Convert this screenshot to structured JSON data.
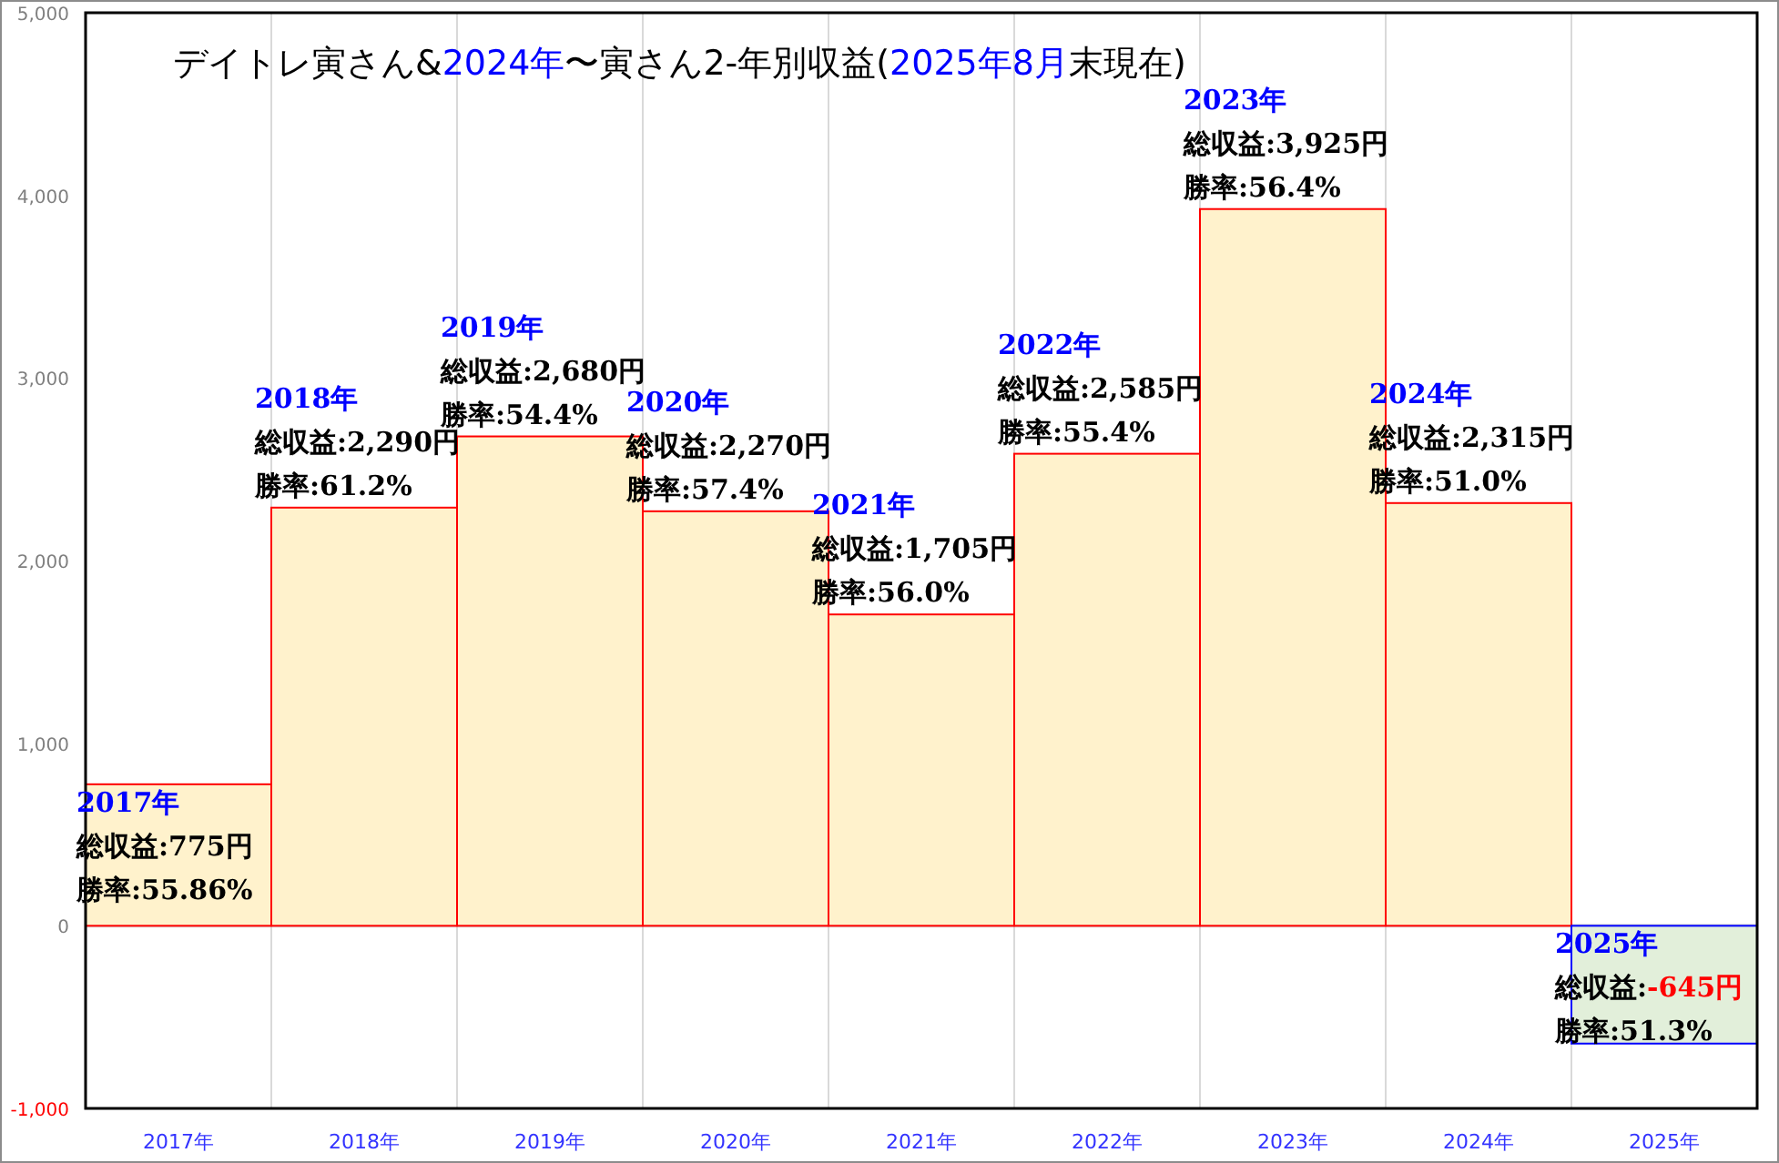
{
  "chart": {
    "title": [
      {
        "text": "デイトレ寅さん&",
        "color": "#000000"
      },
      {
        "text": "2024年",
        "color": "#0000ff"
      },
      {
        "text": "〜寅さん2-年別収益(",
        "color": "#000000"
      },
      {
        "text": "2025年8月",
        "color": "#0000ff"
      },
      {
        "text": "末現在)",
        "color": "#000000"
      }
    ],
    "bar_labels": [
      {
        "year": "2017年",
        "profit_label": "総収益:",
        "profit": "775円",
        "rate": "勝率:55.86%"
      },
      {
        "year": "2018年",
        "profit_label": "総収益:",
        "profit": "2,290円",
        "rate": "勝率:61.2%"
      },
      {
        "year": "2019年",
        "profit_label": "総収益:",
        "profit": "2,680円",
        "rate": "勝率:54.4%"
      },
      {
        "year": "2020年",
        "profit_label": "総収益:",
        "profit": "2,270円",
        "rate": "勝率:57.4%"
      },
      {
        "year": "2021年",
        "profit_label": "総収益:",
        "profit": "1,705円",
        "rate": "勝率:56.0%"
      },
      {
        "year": "2022年",
        "profit_label": "総収益:",
        "profit": "2,585円",
        "rate": "勝率:55.4%"
      },
      {
        "year": "2023年",
        "profit_label": "総収益:",
        "profit": "3,925円",
        "rate": "勝率:56.4%"
      },
      {
        "year": "2024年",
        "profit_label": "総収益:",
        "profit": "2,315円",
        "rate": "勝率:51.0%"
      },
      {
        "year": "2025年",
        "profit_label": "総収益:",
        "profit": "-645円",
        "rate": "勝率:51.3%"
      }
    ],
    "chart_data": {
      "type": "bar",
      "categories": [
        "2017年",
        "2018年",
        "2019年",
        "2020年",
        "2021年",
        "2022年",
        "2023年",
        "2024年",
        "2025年"
      ],
      "series": [
        {
          "color": "#fff2cc",
          "values": [
            775,
            2290,
            2680,
            2270,
            1705,
            2585,
            3925,
            2315,
            null
          ]
        },
        {
          "color": "#e2efda",
          "values": [
            null,
            null,
            null,
            null,
            null,
            null,
            null,
            null,
            -645
          ]
        }
      ],
      "stacked": true,
      "ylim": [
        -1000,
        5000
      ],
      "yticks": [
        {
          "value": -1000,
          "label": "-1,000"
        },
        {
          "value": 0,
          "label": "0"
        },
        {
          "value": 1000,
          "label": "1,000"
        },
        {
          "value": 2000,
          "label": "2,000"
        },
        {
          "value": 3000,
          "label": "3,000"
        },
        {
          "value": 4000,
          "label": "4,000"
        },
        {
          "value": 5000,
          "label": "5,000"
        }
      ]
    }
  }
}
